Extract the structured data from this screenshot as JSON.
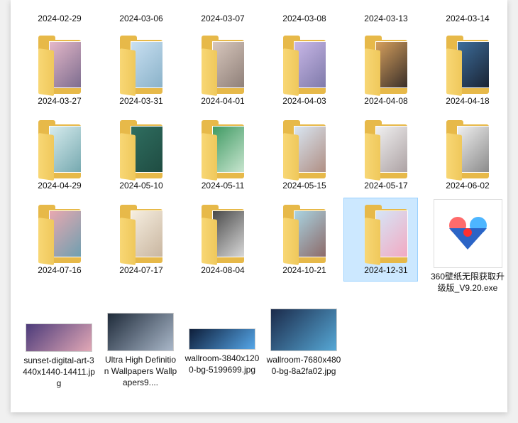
{
  "top_labels": [
    "2024-02-29",
    "2024-03-06",
    "2024-03-07",
    "2024-03-08",
    "2024-03-13",
    "2024-03-14"
  ],
  "folders": [
    {
      "label": "2024-03-27",
      "colors": [
        "#e5b8c9",
        "#7d6d8f"
      ]
    },
    {
      "label": "2024-03-31",
      "colors": [
        "#c9e0f2",
        "#8ab2c9"
      ]
    },
    {
      "label": "2024-04-01",
      "colors": [
        "#d8c7bd",
        "#8f8079"
      ]
    },
    {
      "label": "2024-04-03",
      "colors": [
        "#c9b8e8",
        "#7f7aaa"
      ]
    },
    {
      "label": "2024-04-08",
      "colors": [
        "#d6a05d",
        "#3a2f2a"
      ]
    },
    {
      "label": "2024-04-18",
      "colors": [
        "#3d6e9c",
        "#1a2333"
      ]
    },
    {
      "label": "2024-04-29",
      "colors": [
        "#d7ecee",
        "#76a9b0"
      ]
    },
    {
      "label": "2024-05-10",
      "colors": [
        "#2f6e60",
        "#1f4c42"
      ]
    },
    {
      "label": "2024-05-11",
      "colors": [
        "#3f9a63",
        "#c8e5cf"
      ]
    },
    {
      "label": "2024-05-15",
      "colors": [
        "#d9e6f2",
        "#b08f84"
      ]
    },
    {
      "label": "2024-05-17",
      "colors": [
        "#f0f0f0",
        "#ada2a4"
      ]
    },
    {
      "label": "2024-06-02",
      "colors": [
        "#efefef",
        "#8b8b8b"
      ]
    },
    {
      "label": "2024-07-16",
      "colors": [
        "#e8a8b0",
        "#6f9fb0"
      ]
    },
    {
      "label": "2024-07-17",
      "colors": [
        "#f6eee0",
        "#c9b6a0"
      ]
    },
    {
      "label": "2024-08-04",
      "colors": [
        "#4a4a4a",
        "#d8d8d8"
      ]
    },
    {
      "label": "2024-10-21",
      "colors": [
        "#a9d4e2",
        "#8d6a69"
      ]
    },
    {
      "label": "2024-12-31",
      "colors": [
        "#d5e6f7",
        "#f2a9c2"
      ]
    }
  ],
  "exe": {
    "label": "360壁纸无限获取升级版_V9.20.exe",
    "icon": "heart-app-icon"
  },
  "files": [
    {
      "label": "sunset-digital-art-3440x1440-14411.jpg",
      "colors": [
        "#4c3b7a",
        "#e2a8b6"
      ]
    },
    {
      "label": "Ultra High Definition Wallpapers Wallpapers9....",
      "colors": [
        "#1f2b3a",
        "#a9b7c9"
      ]
    },
    {
      "label": "wallroom-3840x1200-bg-5199699.jpg",
      "colors": [
        "#0e1e3a",
        "#55a6e8"
      ]
    },
    {
      "label": "wallroom-7680x4800-bg-8a2fa02.jpg",
      "colors": [
        "#1b2a4a",
        "#56a8d6"
      ]
    }
  ]
}
